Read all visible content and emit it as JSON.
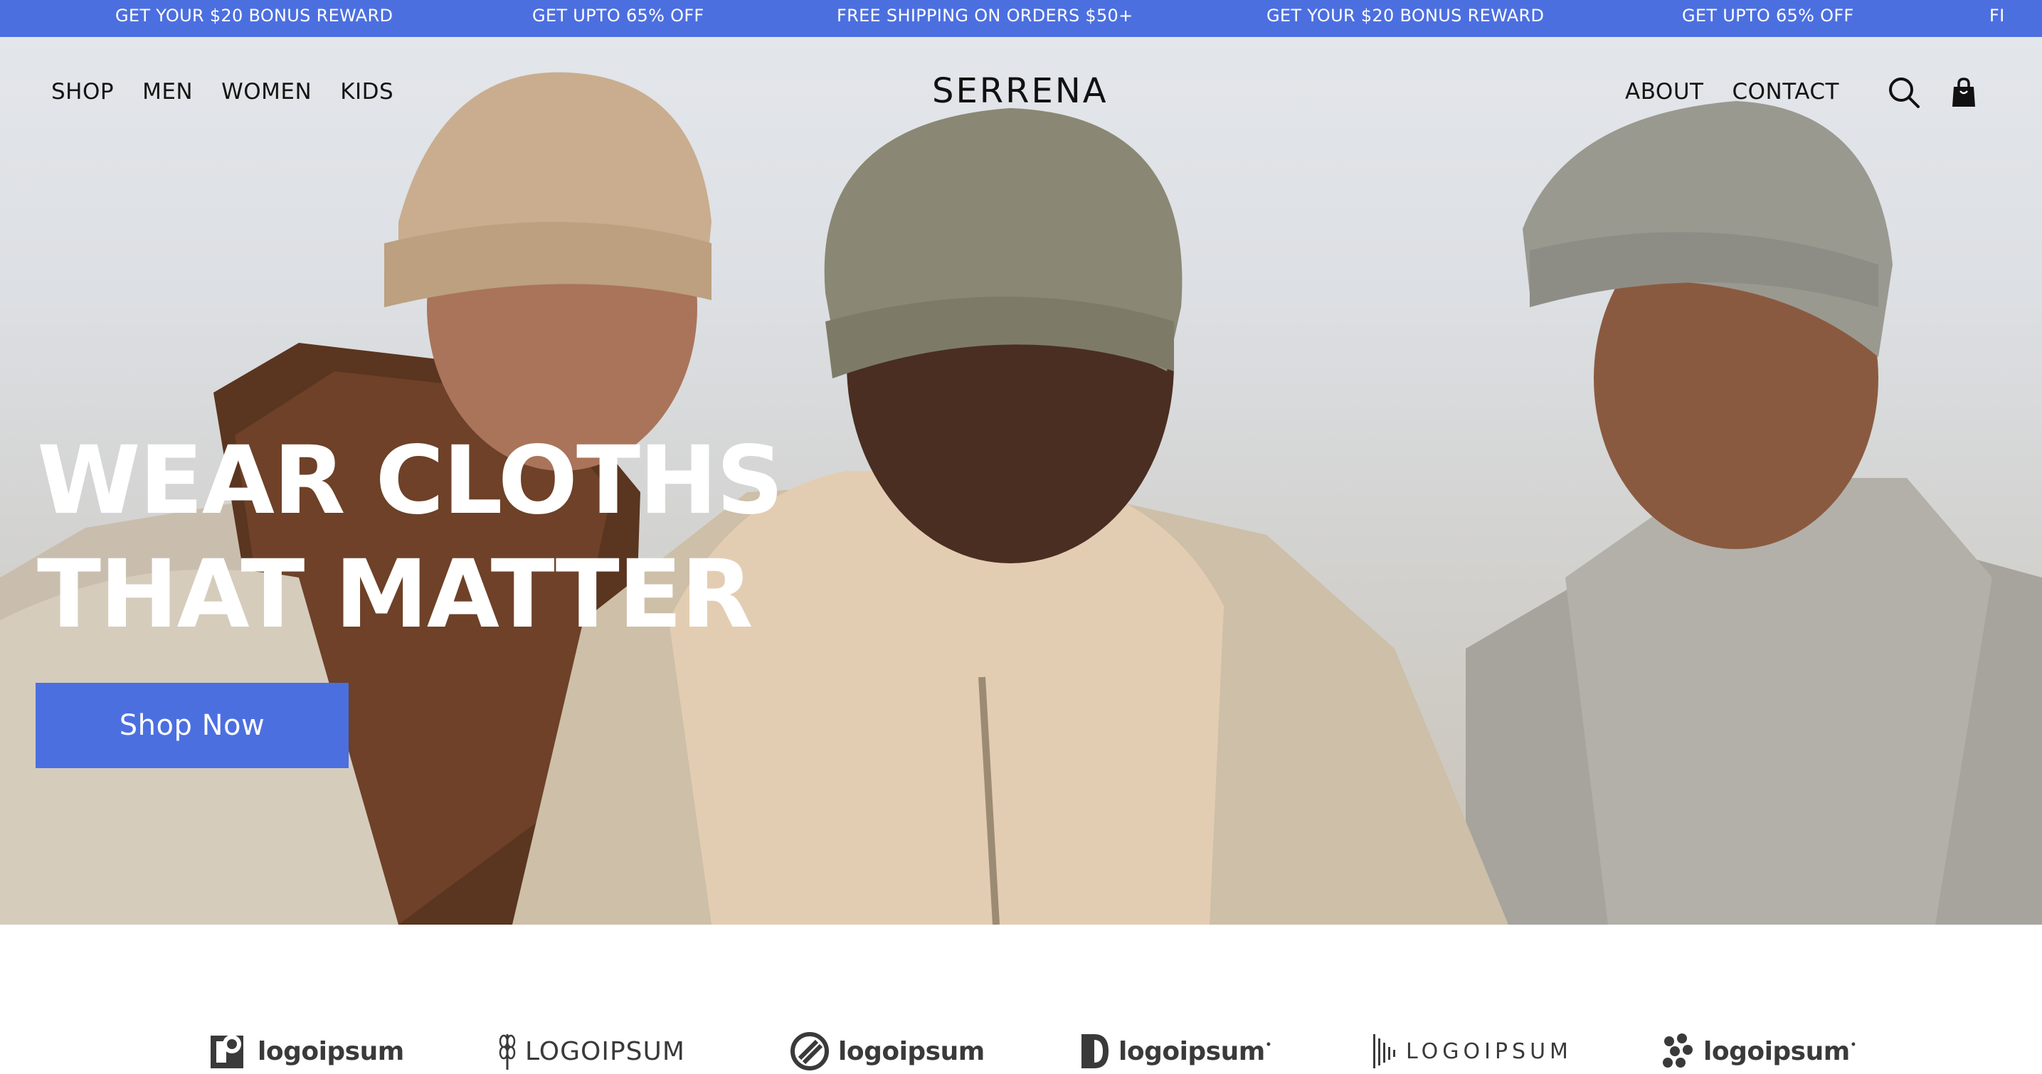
{
  "announcement": {
    "items": [
      "GET YOUR $20 BONUS REWARD",
      "GET UPTO 65% OFF",
      "FREE SHIPPING ON ORDERS $50+",
      "GET YOUR $20 BONUS REWARD",
      "GET UPTO 65% OFF",
      "FI"
    ],
    "background": "#4c6fe0",
    "text_color": "#ffffff"
  },
  "header": {
    "brand": "SERRENA",
    "left_nav": [
      "SHOP",
      "MEN",
      "WOMEN",
      "KIDS"
    ],
    "right_nav": [
      "ABOUT",
      "CONTACT"
    ],
    "icons": [
      "search-icon",
      "shopping-bag-icon"
    ]
  },
  "hero": {
    "headline_line1": "WEAR CLOTHS",
    "headline_line2": "THAT MATTER",
    "cta_label": "Shop Now",
    "accent": "#4c6fe0"
  },
  "logos": [
    {
      "text": "logoipsum",
      "icon": "square-logo-icon"
    },
    {
      "text": "LOGOIPSUM",
      "icon": "wheat-logo-icon"
    },
    {
      "text": "logoipsum",
      "icon": "circle-slash-logo-icon"
    },
    {
      "text": "logoipsum",
      "icon": "half-circle-logo-icon"
    },
    {
      "text": "LOGOIPSUM",
      "icon": "bars-logo-icon"
    },
    {
      "text": "logoipsum",
      "icon": "dots-logo-icon"
    }
  ]
}
